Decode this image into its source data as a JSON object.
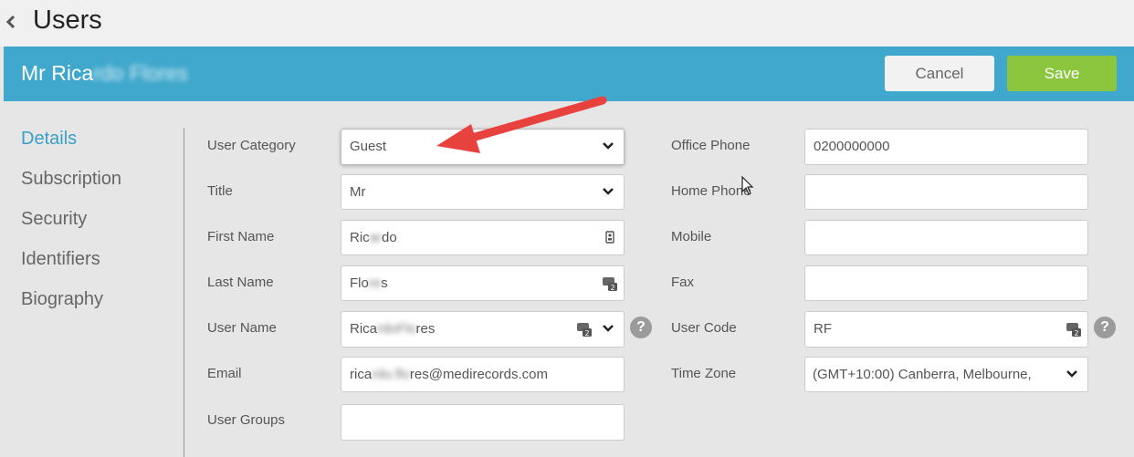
{
  "page": {
    "title": "Users"
  },
  "header": {
    "user_name_visible": "Mr Rica",
    "user_name_blurred": "rdo Flores"
  },
  "toolbar": {
    "cancel_label": "Cancel",
    "save_label": "Save"
  },
  "sidebar": {
    "items": [
      {
        "label": "Details",
        "active": true
      },
      {
        "label": "Subscription",
        "active": false
      },
      {
        "label": "Security",
        "active": false
      },
      {
        "label": "Identifiers",
        "active": false
      },
      {
        "label": "Biography",
        "active": false
      }
    ]
  },
  "form": {
    "user_category": {
      "label": "User Category",
      "value": "Guest"
    },
    "title": {
      "label": "Title",
      "value": "Mr"
    },
    "first_name": {
      "label": "First Name",
      "value_a": "Ric",
      "value_blur": "ar",
      "value_b": "do"
    },
    "last_name": {
      "label": "Last Name",
      "value_a": "Flo",
      "value_blur": "re",
      "value_b": "s"
    },
    "user_name": {
      "label": "User Name",
      "value_a": "Rica",
      "value_blur": "rdoFlo",
      "value_b": "res"
    },
    "email": {
      "label": "Email",
      "value_a": "rica",
      "value_blur": "rdo.flo",
      "value_b": "res@medirecords.com"
    },
    "user_groups": {
      "label": "User Groups",
      "value": ""
    },
    "office_phone": {
      "label": "Office Phone",
      "value": "0200000000"
    },
    "home_phone": {
      "label": "Home Phone",
      "value": ""
    },
    "mobile": {
      "label": "Mobile",
      "value": ""
    },
    "fax": {
      "label": "Fax",
      "value": ""
    },
    "user_code": {
      "label": "User Code",
      "value": "RF"
    },
    "time_zone": {
      "label": "Time Zone",
      "value": "(GMT+10:00) Canberra, Melbourne,"
    }
  },
  "help_glyph": "?",
  "colors": {
    "header": "#40a8cc",
    "save": "#8cc63f",
    "active_nav": "#3aa0c8",
    "arrow": "#e8423f"
  }
}
